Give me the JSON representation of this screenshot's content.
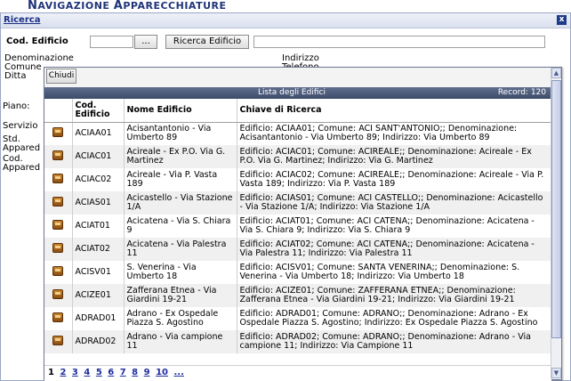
{
  "app": {
    "title_first": "N",
    "title_rest": "AVIGAZIONE",
    "title_first2": "A",
    "title_rest2": "PPARECCHIATURE"
  },
  "search": {
    "header": "Ricerca",
    "close_glyph": "x",
    "cod_label": "Cod. Edificio",
    "cod_value": "",
    "dots_label": "...",
    "ricerca_button": "Ricerca Edificio",
    "name_value": ""
  },
  "background_labels": {
    "denominazione": "Denominazione",
    "comune": "Comune",
    "ditta": "Ditta",
    "indirizzo": "Indirizzo",
    "telefono": "Telefono",
    "piano": "Piano:",
    "servizio": "Servizio",
    "std_line1": "Std.",
    "std_line2": "Appared",
    "cod_line1": "Cod.",
    "cod_line2": "Appared"
  },
  "popup": {
    "close_button": "Chiudi",
    "table_title": "Lista degli Edifici",
    "record_label": "Record: 120",
    "columns": [
      "Cod. Edificio",
      "Nome Edificio",
      "Chiave di Ricerca"
    ],
    "rows": [
      {
        "code": "ACIAA01",
        "name": "Acisantantonio - Via Umberto 89",
        "key": "Edificio: ACIAA01; Comune: ACI SANT'ANTONIO;; Denominazione: Acisantantonio - Via Umberto 89; Indirizzo: Via Umberto 89"
      },
      {
        "code": "ACIAC01",
        "name": "Acireale - Ex P.O. Via G. Martinez",
        "key": "Edificio: ACIAC01; Comune: ACIREALE;; Denominazione: Acireale - Ex P.O. Via G. Martinez; Indirizzo: Via G. Martinez"
      },
      {
        "code": "ACIAC02",
        "name": "Acireale - Via P. Vasta 189",
        "key": "Edificio: ACIAC02; Comune: ACIREALE;; Denominazione: Acireale - Via P. Vasta 189; Indirizzo: Via P. Vasta 189"
      },
      {
        "code": "ACIAS01",
        "name": "Acicastello - Via Stazione 1/A",
        "key": "Edificio: ACIAS01; Comune: ACI CASTELLO;; Denominazione: Acicastello - Via Stazione 1/A; Indirizzo: Via Stazione 1/A"
      },
      {
        "code": "ACIAT01",
        "name": "Acicatena - Via S. Chiara 9",
        "key": "Edificio: ACIAT01; Comune: ACI CATENA;; Denominazione: Acicatena - Via S. Chiara 9; Indirizzo: Via S. Chiara 9"
      },
      {
        "code": "ACIAT02",
        "name": "Acicatena - Via Palestra 11",
        "key": "Edificio: ACIAT02; Comune: ACI CATENA;; Denominazione: Acicatena - Via Palestra 11; Indirizzo: Via Palestra 11"
      },
      {
        "code": "ACISV01",
        "name": "S. Venerina - Via Umberto 18",
        "key": "Edificio: ACISV01; Comune: SANTA VENERINA;; Denominazione: S. Venerina - Via Umberto 18; Indirizzo: Via Umberto 18"
      },
      {
        "code": "ACIZE01",
        "name": "Zafferana Etnea - Via Giardini 19-21",
        "key": "Edificio: ACIZE01; Comune: ZAFFERANA ETNEA;; Denominazione: Zafferana Etnea - Via Giardini 19-21; Indirizzo: Via Giardini 19-21"
      },
      {
        "code": "ADRAD01",
        "name": "Adrano - Ex Ospedale Piazza S. Agostino",
        "key": "Edificio: ADRAD01; Comune: ADRANO;; Denominazione: Adrano - Ex Ospedale Piazza S. Agostino; Indirizzo: Ex Ospedale Piazza S. Agostino"
      },
      {
        "code": "ADRAD02",
        "name": "Adrano - Via campione 11",
        "key": "Edificio: ADRAD02; Comune: ADRANO;; Denominazione: Adrano - Via campione 11; Indirizzo: Via Campione 11"
      }
    ],
    "pages": [
      "1",
      "2",
      "3",
      "4",
      "5",
      "6",
      "7",
      "8",
      "9",
      "10",
      "..."
    ],
    "current_page": "1"
  },
  "scrollbar": {
    "up": "▲",
    "down": "▼"
  },
  "icons": {
    "row_icon": "building-icon",
    "close_icon": "close-icon"
  }
}
